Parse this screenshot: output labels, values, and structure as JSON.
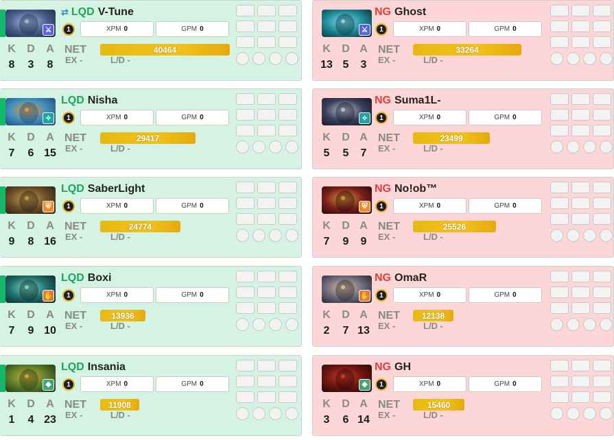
{
  "labels": {
    "k": "K",
    "d": "D",
    "a": "A",
    "net": "NET",
    "ex": "EX -",
    "ld": "L/D -",
    "xpm": "XPM",
    "gpm": "GPM"
  },
  "colors": {
    "radiant_bg": "#d4f3e2",
    "dire_bg": "#fdd7d7",
    "radiant_team": "#1aa55c",
    "dire_team": "#e83b3b",
    "networth": "#f1c21b"
  },
  "radiant": [
    {
      "team": "LQD",
      "name": "V-Tune",
      "level": "1",
      "xpm": "0",
      "gpm": "0",
      "k": "8",
      "d": "3",
      "a": "8",
      "net": "40464",
      "net_fraction": 0.86,
      "role_icon": "sword-icon",
      "role_color": "#5a63d6",
      "swapped": true
    },
    {
      "team": "LQD",
      "name": "Nisha",
      "level": "1",
      "xpm": "0",
      "gpm": "0",
      "k": "7",
      "d": "6",
      "a": "15",
      "net": "29417",
      "net_fraction": 0.63,
      "role_icon": "ward-icon",
      "role_color": "#1fa2a2"
    },
    {
      "team": "LQD",
      "name": "SaberLight",
      "level": "1",
      "xpm": "0",
      "gpm": "0",
      "k": "9",
      "d": "8",
      "a": "16",
      "net": "24774",
      "net_fraction": 0.53,
      "role_icon": "shield-icon",
      "role_color": "#ee8a2a"
    },
    {
      "team": "LQD",
      "name": "Boxi",
      "level": "1",
      "xpm": "0",
      "gpm": "0",
      "k": "7",
      "d": "9",
      "a": "10",
      "net": "13936",
      "net_fraction": 0.3,
      "role_icon": "hand-icon",
      "role_color": "#e0783a"
    },
    {
      "team": "LQD",
      "name": "Insania",
      "level": "1",
      "xpm": "0",
      "gpm": "0",
      "k": "1",
      "d": "4",
      "a": "23",
      "net": "11908",
      "net_fraction": 0.26,
      "role_icon": "support-icon",
      "role_color": "#3ba777"
    }
  ],
  "dire": [
    {
      "team": "NG",
      "name": "Ghost",
      "level": "1",
      "xpm": "0",
      "gpm": "0",
      "k": "13",
      "d": "5",
      "a": "3",
      "net": "33264",
      "net_fraction": 0.72,
      "role_icon": "sword-icon",
      "role_color": "#5a63d6"
    },
    {
      "team": "NG",
      "name": "Suma1L-",
      "level": "1",
      "xpm": "0",
      "gpm": "0",
      "k": "5",
      "d": "5",
      "a": "7",
      "net": "23499",
      "net_fraction": 0.51,
      "role_icon": "ward-icon",
      "role_color": "#1fa2a2"
    },
    {
      "team": "NG",
      "name": "No!ob™",
      "level": "1",
      "xpm": "0",
      "gpm": "0",
      "k": "7",
      "d": "9",
      "a": "9",
      "net": "25526",
      "net_fraction": 0.55,
      "role_icon": "shield-icon",
      "role_color": "#ee8a2a"
    },
    {
      "team": "NG",
      "name": "OmaR",
      "level": "1",
      "xpm": "0",
      "gpm": "0",
      "k": "2",
      "d": "7",
      "a": "13",
      "net": "12138",
      "net_fraction": 0.27,
      "role_icon": "hand-icon",
      "role_color": "#e0783a"
    },
    {
      "team": "NG",
      "name": "GH",
      "level": "1",
      "xpm": "0",
      "gpm": "0",
      "k": "3",
      "d": "6",
      "a": "14",
      "net": "15460",
      "net_fraction": 0.34,
      "role_icon": "support-icon",
      "role_color": "#3ba777"
    }
  ]
}
